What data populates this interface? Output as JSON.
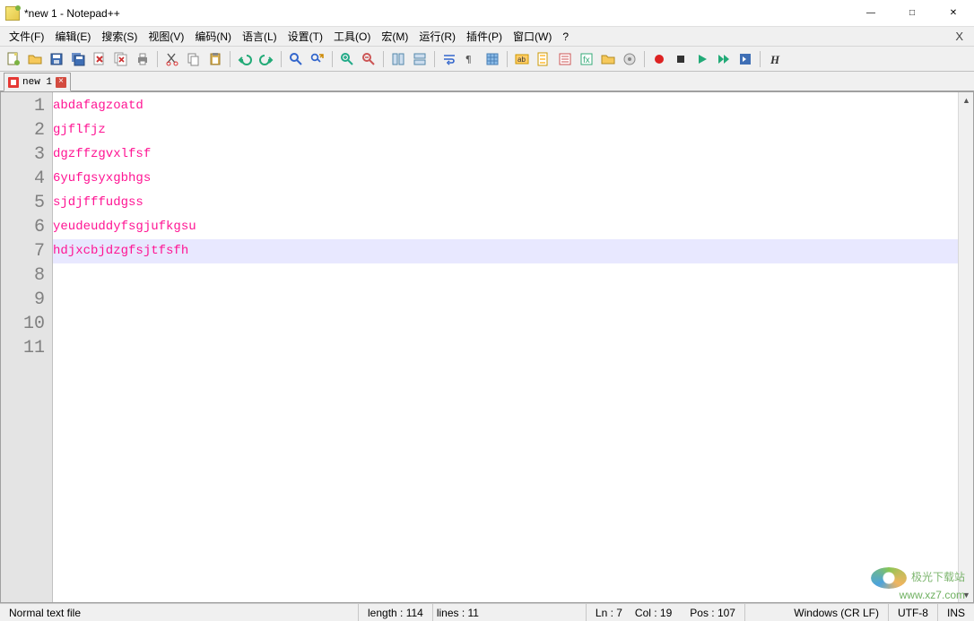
{
  "window": {
    "title": "*new 1 - Notepad++"
  },
  "menubar": {
    "items": [
      "文件(F)",
      "编辑(E)",
      "搜索(S)",
      "视图(V)",
      "编码(N)",
      "语言(L)",
      "设置(T)",
      "工具(O)",
      "宏(M)",
      "运行(R)",
      "插件(P)",
      "窗口(W)",
      "?"
    ],
    "close_label": "X"
  },
  "toolbar_icons": [
    "new-file-icon",
    "open-file-icon",
    "save-icon",
    "save-all-icon",
    "close-icon",
    "close-all-icon",
    "print-icon",
    "sep",
    "cut-icon",
    "copy-icon",
    "paste-icon",
    "sep",
    "undo-icon",
    "redo-icon",
    "sep",
    "find-icon",
    "replace-icon",
    "sep",
    "zoom-in-icon",
    "zoom-out-icon",
    "sep",
    "sync-v-icon",
    "sync-h-icon",
    "sep",
    "wordwrap-icon",
    "all-chars-icon",
    "indent-guide-icon",
    "sep",
    "lang-icon",
    "doc-map-icon",
    "doc-list-icon",
    "func-list-icon",
    "folder-icon",
    "monitor-icon",
    "sep",
    "record-macro-icon",
    "stop-macro-icon",
    "play-macro-icon",
    "fast-macro-icon",
    "save-macro-icon",
    "sep",
    "bold-h-icon"
  ],
  "tab": {
    "label": "new 1"
  },
  "editor": {
    "lines": [
      "abdafagzoatd",
      "gjflfjz",
      "dgzffzgvxlfsf",
      "6yufgsyxgbhgs",
      "sjdjfffudgss",
      "yeudeuddyfsgjufkgsu",
      "hdjxcbjdzgfsjtfsfh"
    ],
    "visible_line_numbers": [
      "1",
      "2",
      "3",
      "4",
      "5",
      "6",
      "7",
      "8",
      "9",
      "10",
      "11"
    ],
    "current_line_index": 6
  },
  "statusbar": {
    "filetype": "Normal text file",
    "length": "length : 114",
    "lines": "lines : 11",
    "ln": "Ln : 7",
    "col": "Col : 19",
    "pos": "Pos : 107",
    "eol": "Windows (CR LF)",
    "encoding": "UTF-8",
    "mode": "INS"
  },
  "watermark": {
    "line1": "极光下载站",
    "line2": "www.xz7.com"
  }
}
